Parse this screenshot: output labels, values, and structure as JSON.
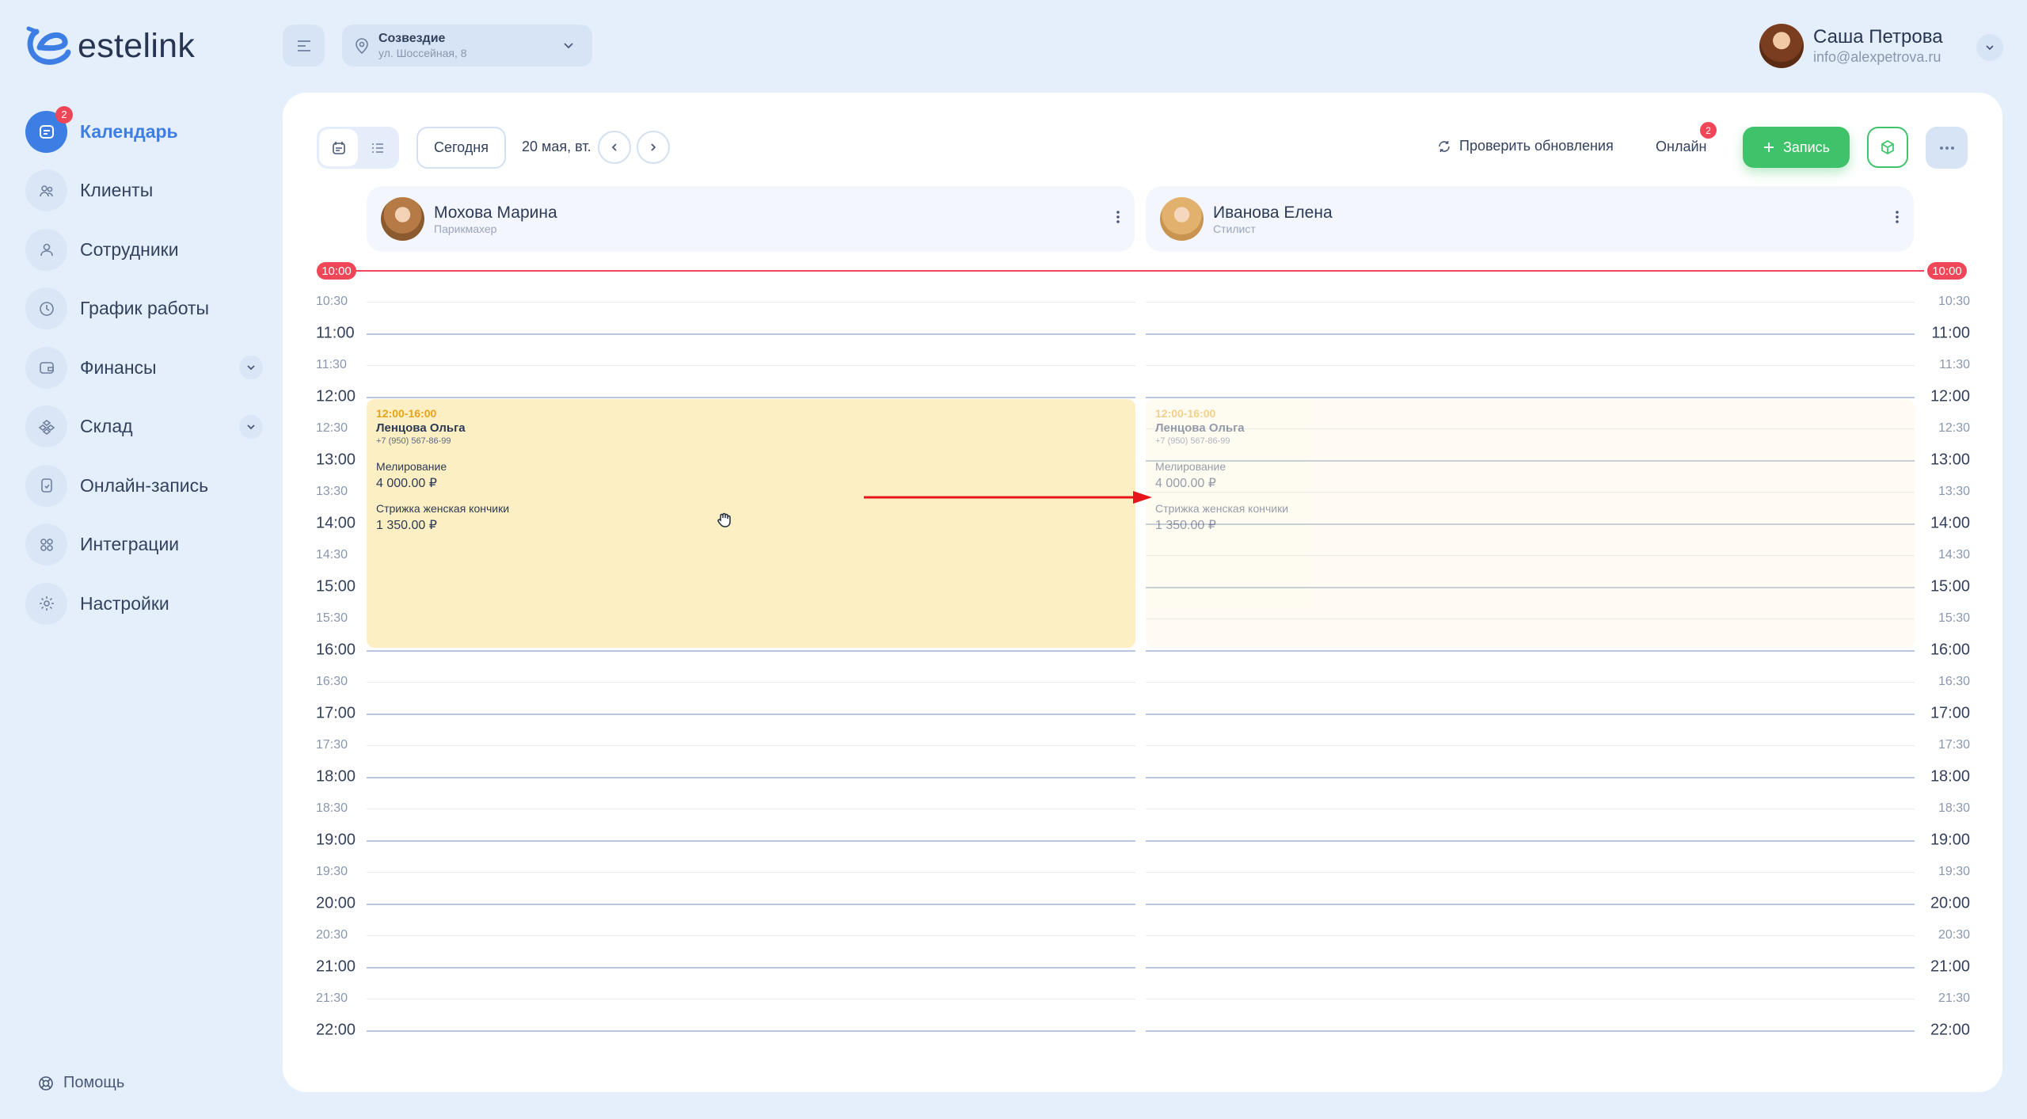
{
  "brand": {
    "name": "estelink"
  },
  "sidebar": {
    "items": [
      {
        "label": "Календарь",
        "icon": "calendar-icon",
        "active": true,
        "badge": "2"
      },
      {
        "label": "Клиенты",
        "icon": "clients-icon"
      },
      {
        "label": "Сотрудники",
        "icon": "user-icon"
      },
      {
        "label": "График работы",
        "icon": "clock-icon"
      },
      {
        "label": "Финансы",
        "icon": "wallet-icon",
        "expandable": true
      },
      {
        "label": "Склад",
        "icon": "warehouse-icon",
        "expandable": true
      },
      {
        "label": "Онлайн-запись",
        "icon": "phone-icon"
      },
      {
        "label": "Интеграции",
        "icon": "integrations-icon"
      },
      {
        "label": "Настройки",
        "icon": "gear-icon"
      }
    ],
    "help_label": "Помощь"
  },
  "topbar": {
    "branch": {
      "name": "Созвездие",
      "address": "ул. Шоссейная, 8"
    },
    "user": {
      "name": "Саша Петрова",
      "email": "info@alexpetrova.ru"
    }
  },
  "toolbar": {
    "today_label": "Сегодня",
    "date_label": "20 мая, вт.",
    "check_updates_label": "Проверить обновления",
    "online_label": "Онлайн",
    "online_badge": "2",
    "add_label": "Запись"
  },
  "staff": [
    {
      "name": "Мохова Марина",
      "role": "Парикмахер"
    },
    {
      "name": "Иванова Елена",
      "role": "Стилист"
    }
  ],
  "timeline": {
    "now_label": "10:00",
    "slots": [
      "10:30",
      "11:00",
      "11:30",
      "12:00",
      "12:30",
      "13:00",
      "13:30",
      "14:00",
      "14:30",
      "15:00",
      "15:30",
      "16:00",
      "16:30",
      "17:00",
      "17:30",
      "18:00",
      "18:30",
      "19:00",
      "19:30",
      "20:00",
      "20:30",
      "21:00",
      "21:30",
      "22:00"
    ]
  },
  "appointment": {
    "time": "12:00-16:00",
    "client": "Ленцова Ольга",
    "phone": "+7 (950) 567-86-99",
    "services": [
      {
        "name": "Мелирование",
        "price": "4 000.00 ₽"
      },
      {
        "name": "Стрижка женская кончики",
        "price": "1 350.00 ₽"
      }
    ]
  },
  "colors": {
    "accent": "#3d7ee4",
    "success": "#3ec36a",
    "danger": "#f04657",
    "appointment": "#fdefc4",
    "background": "#e5effb"
  }
}
